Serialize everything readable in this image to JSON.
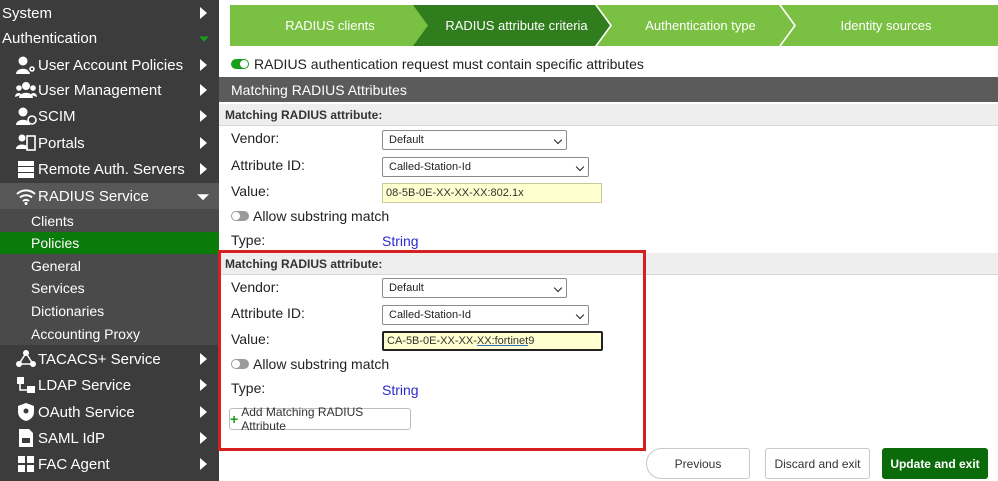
{
  "sidebar": {
    "top_items": [
      {
        "label": "System"
      },
      {
        "label": "Authentication"
      }
    ],
    "items": [
      {
        "label": "User Account Policies",
        "icon": "user-gear-icon"
      },
      {
        "label": "User Management",
        "icon": "users-icon"
      },
      {
        "label": "SCIM",
        "icon": "user-sync-icon"
      },
      {
        "label": "Portals",
        "icon": "portal-icon"
      },
      {
        "label": "Remote Auth. Servers",
        "icon": "server-icon"
      },
      {
        "label": "RADIUS Service",
        "icon": "wifi-icon"
      },
      {
        "label": "TACACS+ Service",
        "icon": "tacacs-icon"
      },
      {
        "label": "LDAP Service",
        "icon": "ldap-icon"
      },
      {
        "label": "OAuth Service",
        "icon": "shield-icon"
      },
      {
        "label": "SAML IdP",
        "icon": "saml-icon"
      },
      {
        "label": "FAC Agent",
        "icon": "agent-icon"
      }
    ],
    "radius_sub": [
      {
        "label": "Clients"
      },
      {
        "label": "Policies"
      },
      {
        "label": "General"
      },
      {
        "label": "Services"
      },
      {
        "label": "Dictionaries"
      },
      {
        "label": "Accounting Proxy"
      }
    ]
  },
  "steps": [
    {
      "label": "RADIUS clients"
    },
    {
      "label": "RADIUS attribute criteria"
    },
    {
      "label": "Authentication type"
    },
    {
      "label": "Identity sources"
    }
  ],
  "main": {
    "toggle_label": "RADIUS authentication request must contain specific attributes",
    "section_title": "Matching RADIUS Attributes",
    "blocks": [
      {
        "header": "Matching RADIUS attribute:",
        "vendor_label": "Vendor:",
        "vendor_value": "Default",
        "attr_label": "Attribute ID:",
        "attr_value": "Called-Station-Id",
        "value_label": "Value:",
        "value": "08-5B-0E-XX-XX-XX:802.1x",
        "substring_label": "Allow substring match",
        "type_label": "Type:",
        "type_value": "String"
      },
      {
        "header": "Matching RADIUS attribute:",
        "vendor_label": "Vendor:",
        "vendor_value": "Default",
        "attr_label": "Attribute ID:",
        "attr_value": "Called-Station-Id",
        "value_label": "Value:",
        "value_prefix": "CA-5B-0E-XX-XX-",
        "value_underlined": "XX:fortinet",
        "value_suffix": "9",
        "substring_label": "Allow substring match",
        "type_label": "Type:",
        "type_value": "String"
      }
    ],
    "add_button": "Add Matching RADIUS Attribute"
  },
  "footer": {
    "previous": "Previous",
    "discard": "Discard and exit",
    "update": "Update and exit"
  },
  "colors": {
    "step_green": "#7ac143",
    "step_active": "#2f7d1c",
    "primary_button": "#0b6b0b",
    "highlight_red": "#d42020"
  }
}
